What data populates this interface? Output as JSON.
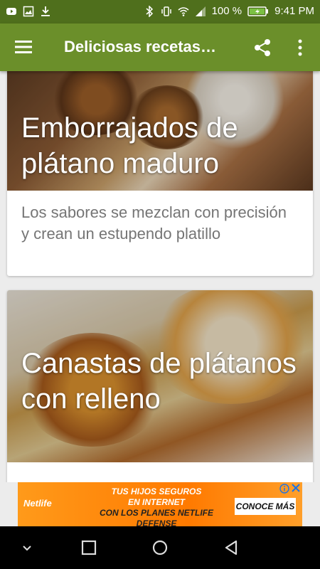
{
  "status_bar": {
    "battery_percent": "100 %",
    "time": "9:41 PM",
    "left_icons": [
      "youtube-icon",
      "image-icon",
      "download-icon"
    ],
    "right_icons": [
      "bluetooth-icon",
      "vibrate-icon",
      "wifi-icon",
      "signal-icon",
      "battery-icon"
    ]
  },
  "app_bar": {
    "title": "Deliciosas recetas…",
    "icons": [
      "menu-icon",
      "share-icon",
      "more-vert-icon"
    ],
    "color": "#6b8f2a"
  },
  "cards": [
    {
      "title": "Emborrajados de plátano maduro",
      "description": "Los sabores se mezclan con precisión y crean un estupendo platillo"
    },
    {
      "title": "Canastas de plátanos con relleno",
      "description": ""
    }
  ],
  "ad": {
    "brand": "Netlife",
    "line1": "TUS HIJOS SEGUROS",
    "line2": "EN INTERNET",
    "line3": "CON LOS PLANES NETLIFE DEFENSE",
    "cta": "CONOCE MÁS"
  },
  "nav_bar": {
    "icons": [
      "hide-keyboard-icon",
      "recents-icon",
      "home-icon",
      "back-icon"
    ]
  }
}
